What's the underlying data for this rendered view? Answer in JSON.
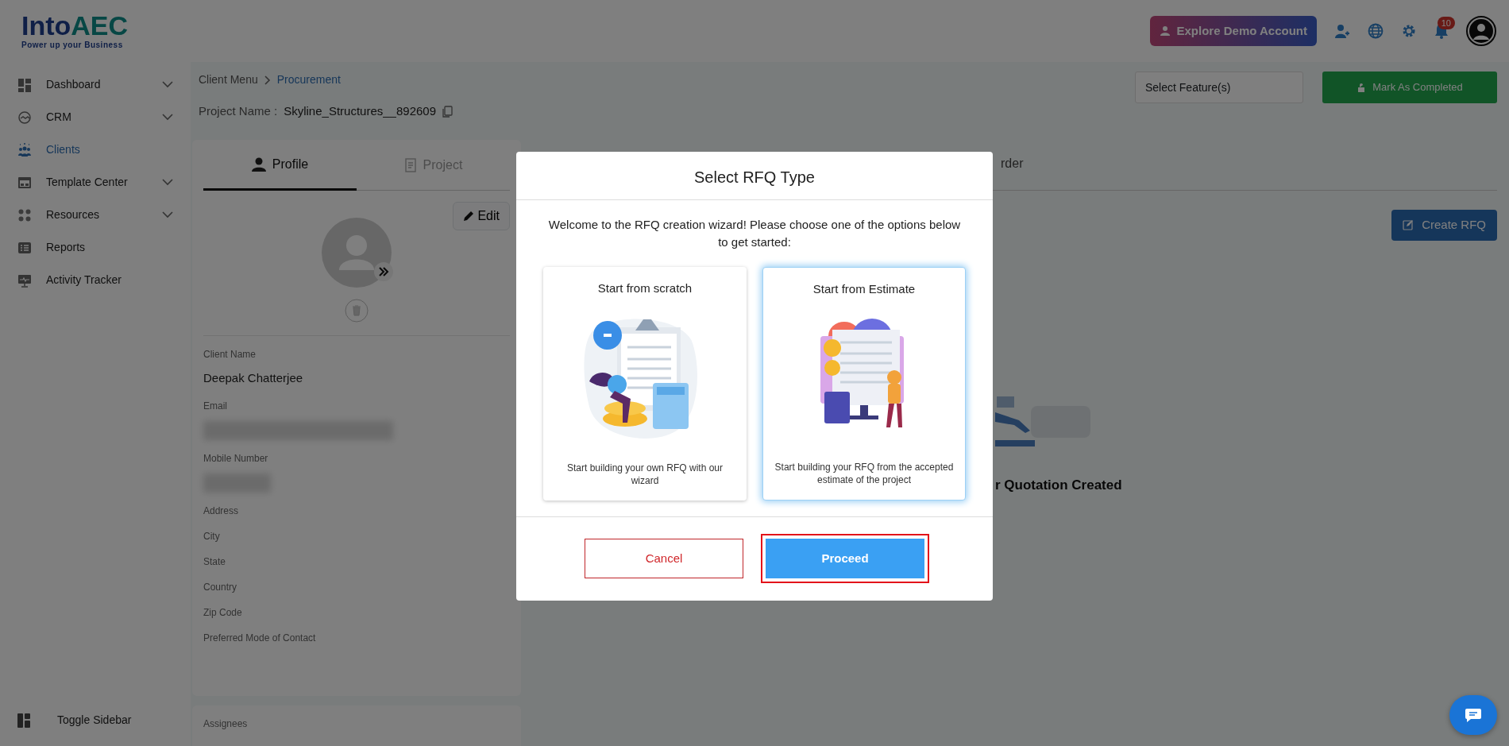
{
  "header": {
    "brand_start": "Into",
    "brand_end": "AEC",
    "tagline": "Power up your Business",
    "demo_button": "Explore Demo Account",
    "notification_count": "10"
  },
  "sidebar": {
    "items": [
      {
        "label": "Dashboard",
        "kind": "dashboard",
        "expandable": true,
        "selected": false
      },
      {
        "label": "CRM",
        "kind": "crm",
        "expandable": true,
        "selected": false
      },
      {
        "label": "Clients",
        "kind": "clients",
        "expandable": false,
        "selected": true
      },
      {
        "label": "Template Center",
        "kind": "template",
        "expandable": true,
        "selected": false
      },
      {
        "label": "Resources",
        "kind": "resources",
        "expandable": true,
        "selected": false
      },
      {
        "label": "Reports",
        "kind": "reports",
        "expandable": false,
        "selected": false
      },
      {
        "label": "Activity Tracker",
        "kind": "activity",
        "expandable": false,
        "selected": false
      }
    ],
    "toggle": "Toggle Sidebar"
  },
  "breadcrumb": [
    {
      "label": "Client Menu",
      "current": false
    },
    {
      "label": "Procurement",
      "current": true
    }
  ],
  "project": {
    "label": "Project Name :",
    "value": "Skyline_Structures__892609"
  },
  "feature_select": {
    "placeholder": "Select Feature(s)"
  },
  "complete_button": "Mark As Completed",
  "tabs": [
    {
      "label": "Profile",
      "kind": "profile",
      "selected": true
    },
    {
      "label": "Project",
      "kind": "project",
      "selected": false
    },
    {
      "label": "rder",
      "kind": "plain",
      "selected": false
    }
  ],
  "profile": {
    "edit_button": "Edit",
    "fields": [
      {
        "label": "Client Name",
        "value": "Deepak Chatterjee",
        "redacted": false
      },
      {
        "label": "Email",
        "redacted": true
      },
      {
        "label": "Mobile Number",
        "redacted": true
      },
      {
        "label": "Address",
        "redacted": false
      },
      {
        "label": "City",
        "redacted": false
      },
      {
        "label": "State",
        "redacted": false
      },
      {
        "label": "Country",
        "redacted": false
      },
      {
        "label": "Zip Code",
        "redacted": false
      },
      {
        "label": "Preferred Mode of Contact",
        "redacted": false
      }
    ]
  },
  "assignees": {
    "label": "Assignees"
  },
  "rfq": {
    "create_button": "Create RFQ",
    "empty_text": "r Quotation Created"
  },
  "modal": {
    "title": "Select RFQ Type",
    "intro": "Welcome to the RFQ creation wizard! Please choose one of the options below to get started:",
    "options": [
      {
        "title": "Start from scratch",
        "description": "Start building your own RFQ with our wizard",
        "kind": "scratch",
        "selected": false
      },
      {
        "title": "Start from Estimate",
        "description": "Start building your RFQ from the accepted estimate of the project",
        "kind": "estimate",
        "selected": true
      }
    ],
    "buttons": [
      {
        "label": "Cancel",
        "kind": "cancel",
        "highlighted": false
      },
      {
        "label": "Proceed",
        "kind": "primary",
        "highlighted": true
      }
    ]
  }
}
